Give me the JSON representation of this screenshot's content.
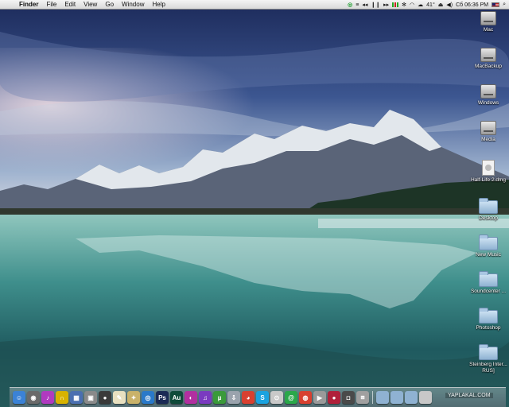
{
  "menubar": {
    "apple_symbol": "",
    "app_name": "Finder",
    "menus": [
      "File",
      "Edit",
      "View",
      "Go",
      "Window",
      "Help"
    ],
    "temperature": "41°",
    "clock": "Сб 06:36 PM",
    "status_icons": [
      "growl-icon",
      "list-icon",
      "media-prev-icon",
      "media-play-icon",
      "media-next-icon",
      "network-bars-icon",
      "bluetooth-icon",
      "wifi-icon",
      "weather-icon",
      "eject-icon",
      "volume-icon",
      "flag-us-icon",
      "spotlight-icon"
    ]
  },
  "desktop_icons": [
    {
      "label": "Mac",
      "kind": "hdd"
    },
    {
      "label": "MacBackup",
      "kind": "hdd"
    },
    {
      "label": "Windows",
      "kind": "hdd"
    },
    {
      "label": "Media",
      "kind": "hdd"
    },
    {
      "label": "Half-Life 2.dmg",
      "kind": "dmg"
    },
    {
      "label": "Desktop",
      "kind": "folder"
    },
    {
      "label": "New Music",
      "kind": "folder"
    },
    {
      "label": "Soundcenter ...",
      "kind": "folder"
    },
    {
      "label": "Photoshop",
      "kind": "folder"
    },
    {
      "label": "Steinberg Inter... RUS]",
      "kind": "folder"
    }
  ],
  "dock": {
    "apps": [
      {
        "name": "finder-icon",
        "color": "#3b82d6",
        "glyph": "☺"
      },
      {
        "name": "dashboard-icon",
        "color": "#6a6a6a",
        "glyph": "◉"
      },
      {
        "name": "itunes-icon",
        "color": "#b03ac0",
        "glyph": "♪"
      },
      {
        "name": "magnet-icon",
        "color": "#d8b300",
        "glyph": "∩"
      },
      {
        "name": "calendar-icon",
        "color": "#4a6fb0",
        "glyph": "▦"
      },
      {
        "name": "preview-icon",
        "color": "#8a8a8a",
        "glyph": "▣"
      },
      {
        "name": "camera-icon",
        "color": "#3a3a3a",
        "glyph": "●"
      },
      {
        "name": "notes-icon",
        "color": "#e8e0c0",
        "glyph": "✎"
      },
      {
        "name": "script-icon",
        "color": "#c9b26a",
        "glyph": "✦"
      },
      {
        "name": "network-icon",
        "color": "#2a79c9",
        "glyph": "◎"
      },
      {
        "name": "photoshop-icon",
        "color": "#1b2a55",
        "glyph": "Ps"
      },
      {
        "name": "audition-icon",
        "color": "#0f4a3a",
        "glyph": "Au"
      },
      {
        "name": "ilife-icon",
        "color": "#b22fa0",
        "glyph": "◐"
      },
      {
        "name": "itunes-purple-icon",
        "color": "#7a3ac0",
        "glyph": "♫"
      },
      {
        "name": "utorrent-icon",
        "color": "#3a9a3a",
        "glyph": "µ"
      },
      {
        "name": "downloads-icon",
        "color": "#9aa3ad",
        "glyph": "⇩"
      },
      {
        "name": "eye-icon",
        "color": "#d94030",
        "glyph": "◕"
      },
      {
        "name": "skype-icon",
        "color": "#1aa3e0",
        "glyph": "S"
      },
      {
        "name": "keychain-icon",
        "color": "#c9c9c9",
        "glyph": "⊙"
      },
      {
        "name": "mail-at-icon",
        "color": "#2aa84a",
        "glyph": "@"
      },
      {
        "name": "chrome-icon",
        "color": "#d84030",
        "glyph": "◍"
      },
      {
        "name": "video-icon",
        "color": "#9a9a9a",
        "glyph": "▶"
      },
      {
        "name": "record-icon",
        "color": "#b0203a",
        "glyph": "●"
      },
      {
        "name": "speaker-icon",
        "color": "#4a4a4a",
        "glyph": "◘"
      },
      {
        "name": "archive-icon",
        "color": "#a0a0a0",
        "glyph": "⧈"
      }
    ],
    "stack_icons": [
      {
        "name": "applications-stack-icon",
        "color": "#8fb2d2"
      },
      {
        "name": "documents-stack-icon",
        "color": "#8fb2d2"
      },
      {
        "name": "downloads-stack-icon",
        "color": "#8fb2d2"
      },
      {
        "name": "trash-icon",
        "color": "#c8c8c8"
      }
    ]
  },
  "watermark": "YAPLAKAL.COM"
}
